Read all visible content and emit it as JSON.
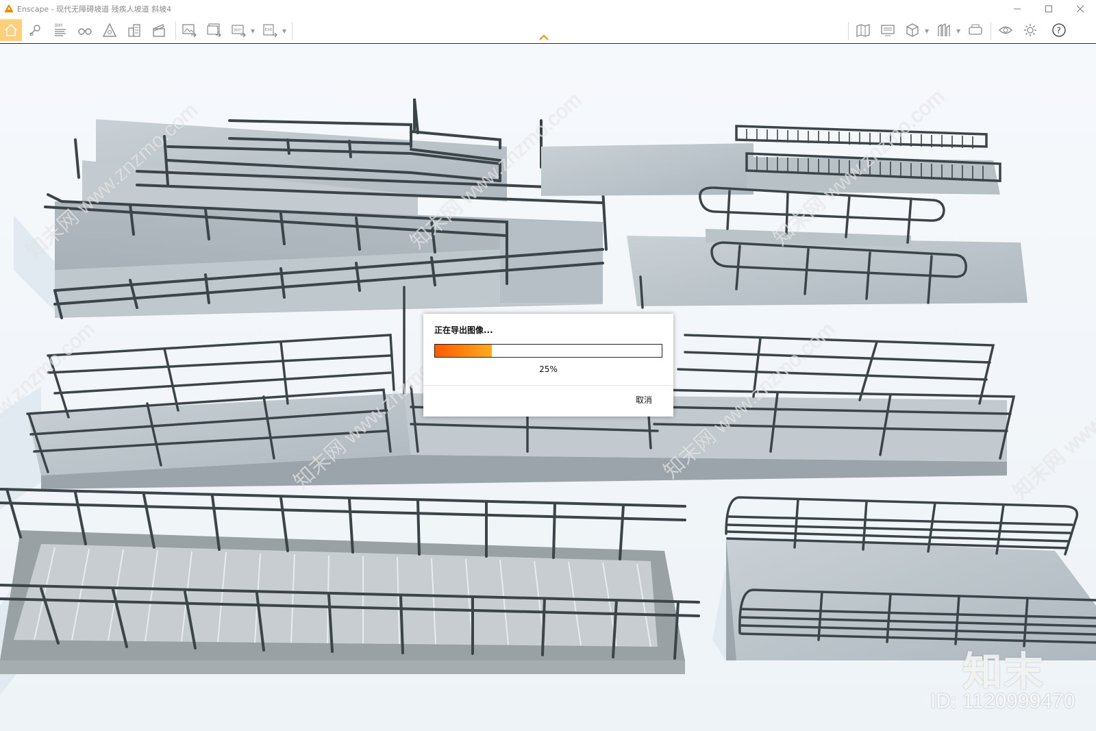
{
  "window": {
    "app_name": "Enscape",
    "document_title": "Enscape - 现代无障碍坡道 残疾人坡道 斜坡4",
    "controls": [
      "minimize-icon",
      "maximize-icon",
      "close-icon"
    ]
  },
  "toolbar": {
    "left_buttons": [
      {
        "name": "home-icon",
        "active": true
      },
      {
        "name": "map-pin-icon"
      },
      {
        "name": "bim-icon",
        "label": "BIM"
      },
      {
        "name": "binoculars-icon"
      },
      {
        "name": "perspective-icon"
      },
      {
        "name": "buildings-icon"
      },
      {
        "name": "clapper-icon"
      },
      {
        "name": "screenshot-export-icon"
      },
      {
        "name": "batch-export-icon"
      },
      {
        "name": "panorama-360-icon",
        "label": "360°"
      },
      {
        "name": "exe-export-icon",
        "label": "EXE"
      }
    ],
    "right_buttons": [
      {
        "name": "map-icon"
      },
      {
        "name": "monitor-icon"
      },
      {
        "name": "cube-icon"
      },
      {
        "name": "asset-library-icon"
      },
      {
        "name": "vr-headset-icon"
      },
      {
        "name": "eye-icon"
      },
      {
        "name": "settings-gear-icon"
      },
      {
        "name": "help-icon"
      }
    ],
    "accent_color": "#ff8a00"
  },
  "dialog": {
    "title": "正在导出图像...",
    "progress_value": 0.25,
    "progress_text": "25%",
    "cancel_label": "取消"
  },
  "watermark": {
    "logo_text": "知末",
    "id_text": "ID: 1120999470",
    "pattern_text": "知末网 www.znzmo.com"
  }
}
